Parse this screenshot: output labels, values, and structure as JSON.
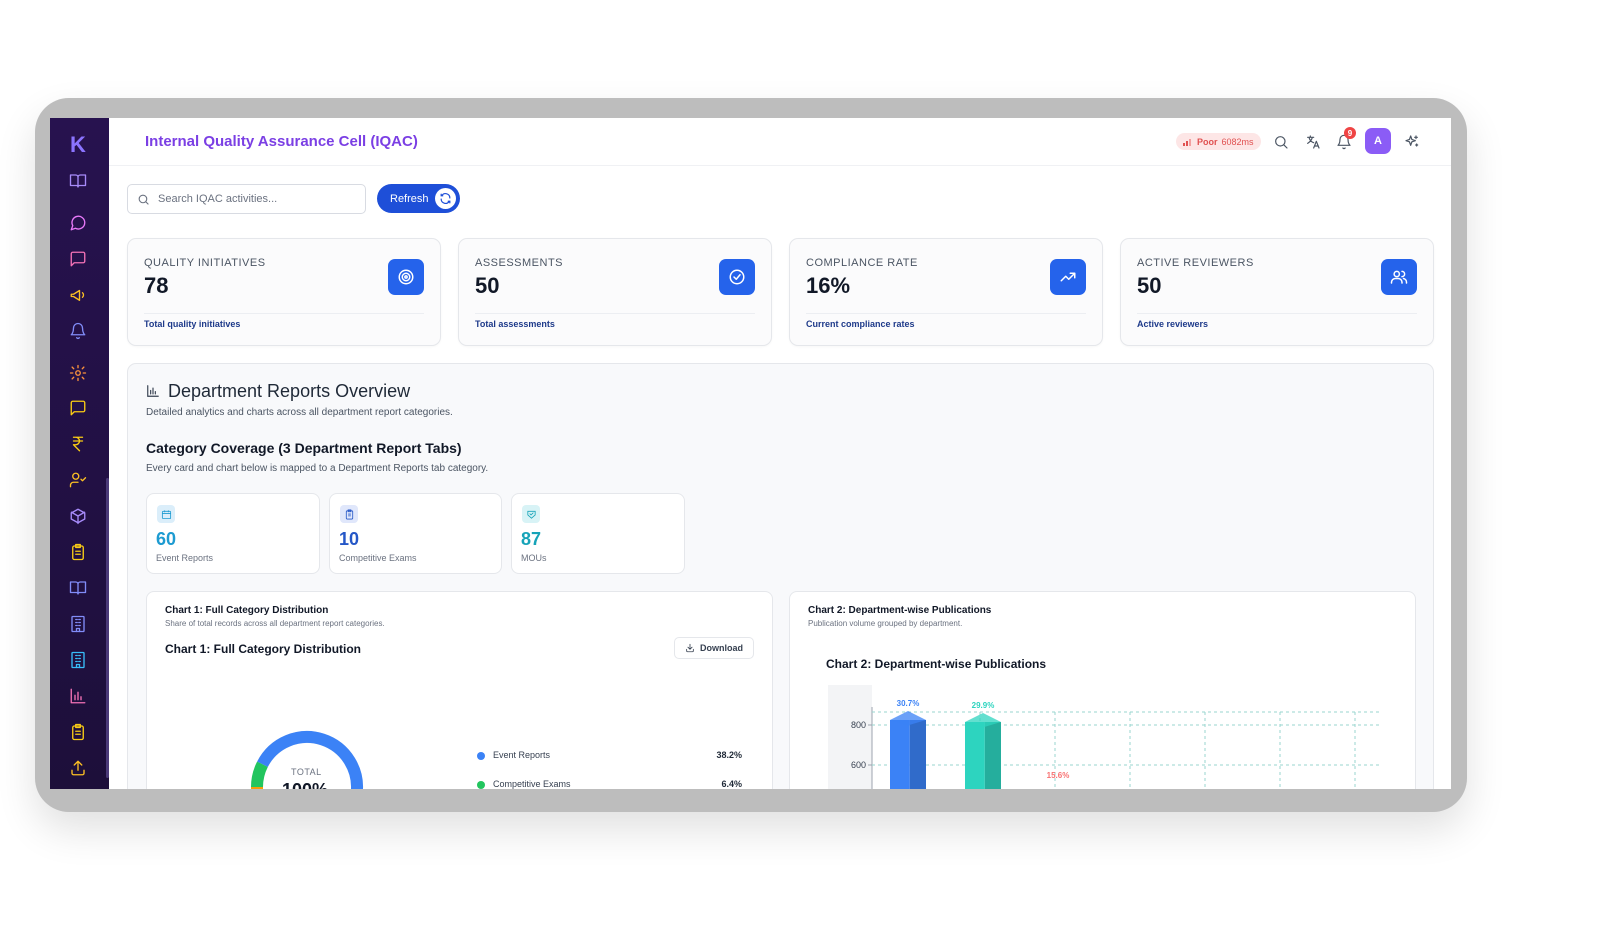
{
  "app": {
    "logo": "K",
    "title": "Internal Quality Assurance Cell (IQAC)"
  },
  "network": {
    "status": "Poor",
    "latency": "6082ms"
  },
  "notifications": {
    "count": "9"
  },
  "user": {
    "avatar_initial": "A"
  },
  "search": {
    "placeholder": "Search IQAC activities..."
  },
  "toolbar": {
    "refresh_label": "Refresh"
  },
  "stats": [
    {
      "label": "QUALITY INITIATIVES",
      "value": "78",
      "sub": "Total quality initiatives",
      "icon": "target-icon"
    },
    {
      "label": "ASSESSMENTS",
      "value": "50",
      "sub": "Total assessments",
      "icon": "check-circle-icon"
    },
    {
      "label": "COMPLIANCE RATE",
      "value": "16%",
      "sub": "Current compliance rates",
      "icon": "trending-up-icon"
    },
    {
      "label": "ACTIVE REVIEWERS",
      "value": "50",
      "sub": "Active reviewers",
      "icon": "users-icon"
    }
  ],
  "overview": {
    "title": "Department Reports Overview",
    "subtitle": "Detailed analytics and charts across all department report categories.",
    "coverage_title": "Category Coverage (3 Department Report Tabs)",
    "coverage_subtitle": "Every card and chart below is mapped to a Department Reports tab category."
  },
  "categories": [
    {
      "value": "60",
      "label": "Event Reports",
      "color": "#1d9bd1",
      "icon": "calendar-icon"
    },
    {
      "value": "10",
      "label": "Competitive Exams",
      "color": "#2557c7",
      "icon": "clipboard-icon"
    },
    {
      "value": "87",
      "label": "MOUs",
      "color": "#16a3b8",
      "icon": "handshake-icon"
    }
  ],
  "chart1": {
    "card_title": "Chart 1: Full Category Distribution",
    "card_subtitle": "Share of total records across all department report categories.",
    "heading": "Chart 1: Full Category Distribution",
    "download_label": "Download",
    "donut_label": "TOTAL",
    "donut_value": "100%"
  },
  "chart2": {
    "card_title": "Chart 2: Department-wise Publications",
    "card_subtitle": "Publication volume grouped by department.",
    "heading": "Chart 2: Department-wise Publications"
  },
  "chart_data": [
    {
      "type": "pie",
      "title": "Chart 1: Full Category Distribution",
      "slices": [
        {
          "name": "Event Reports",
          "value": 38.2,
          "label": "38.2%",
          "color": "#3b82f6"
        },
        {
          "name": "Competitive Exams",
          "value": 6.4,
          "label": "6.4%",
          "color": "#22c55e"
        }
      ]
    },
    {
      "type": "bar",
      "title": "Chart 2: Department-wise Publications",
      "y_ticks": [
        "800",
        "600"
      ],
      "bars": [
        {
          "label": "30.7%",
          "color": "#3b82f6"
        },
        {
          "label": "29.9%",
          "color": "#2dd4bf"
        },
        {
          "label": "15.6%",
          "color": "#f87171"
        }
      ]
    }
  ],
  "sidebar": {
    "icons": [
      "book-icon",
      "chat-icon",
      "message-icon",
      "megaphone-icon",
      "bell-icon",
      "gear-icon",
      "message-icon",
      "rupee-icon",
      "user-check-icon",
      "cube-icon",
      "clipboard-icon",
      "book-icon",
      "building-icon",
      "building-icon",
      "bar-chart-icon",
      "clipboard-icon",
      "upload-icon"
    ]
  }
}
